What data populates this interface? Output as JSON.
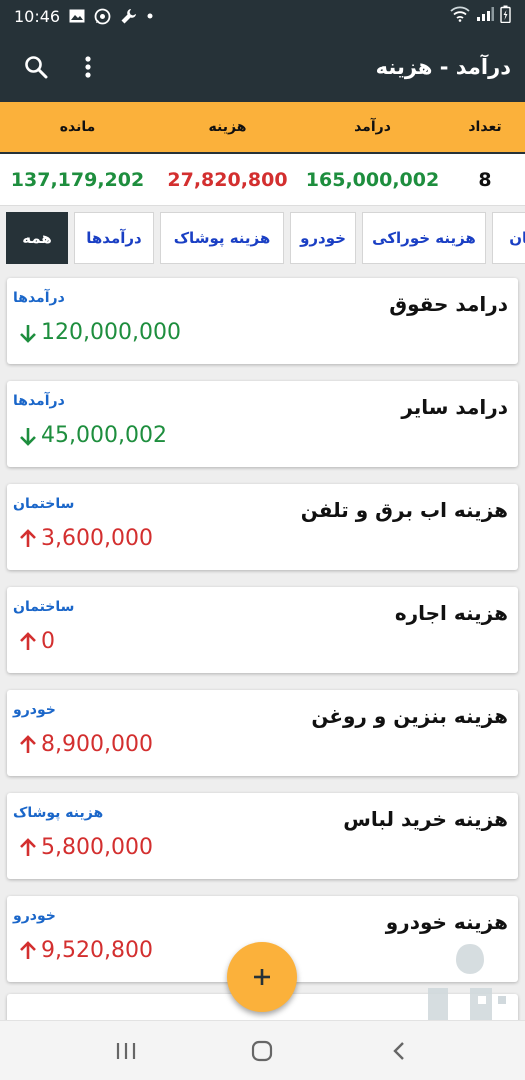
{
  "status_bar": {
    "time": "10:46"
  },
  "app_bar": {
    "title": "درآمد - هزینه"
  },
  "summary": {
    "headers": {
      "count": "تعداد",
      "income": "درآمد",
      "expense": "هزینه",
      "balance": "مانده"
    },
    "values": {
      "count": "8",
      "income": "165,000,002",
      "expense": "27,820,800",
      "balance": "137,179,202"
    }
  },
  "tabs": [
    {
      "label": "همه",
      "active": true
    },
    {
      "label": "درآمدها",
      "active": false
    },
    {
      "label": "هزینه پوشاک",
      "active": false
    },
    {
      "label": "خودرو",
      "active": false
    },
    {
      "label": "هزینه خوراکی",
      "active": false
    },
    {
      "label": "ساختمان",
      "active": false
    }
  ],
  "transactions": [
    {
      "title": "درامد حقوق",
      "category": "درآمدها",
      "amount": "120,000,000",
      "type": "income"
    },
    {
      "title": "درامد سایر",
      "category": "درآمدها",
      "amount": "45,000,002",
      "type": "income"
    },
    {
      "title": "هزینه اب برق و تلفن",
      "category": "ساختمان",
      "amount": "3,600,000",
      "type": "expense"
    },
    {
      "title": "هزینه اجاره",
      "category": "ساختمان",
      "amount": "0",
      "type": "expense"
    },
    {
      "title": "هزینه بنزین و روغن",
      "category": "خودرو",
      "amount": "8,900,000",
      "type": "expense"
    },
    {
      "title": "هزینه خرید لباس",
      "category": "هزینه پوشاک",
      "amount": "5,800,000",
      "type": "expense"
    },
    {
      "title": "هزینه خودرو",
      "category": "خودرو",
      "amount": "9,520,800",
      "type": "expense"
    }
  ],
  "colors": {
    "app_bar": "#263238",
    "accent": "#fbb13b",
    "income": "#1e8e3e",
    "expense": "#d32f2f",
    "tab_text": "#1a3fc4",
    "category_text": "#1a66c9"
  },
  "icons": {
    "app_bar": [
      "search-icon",
      "more-vert-icon"
    ],
    "fab": "plus-icon",
    "nav": [
      "recents-icon",
      "home-icon",
      "back-icon"
    ]
  }
}
